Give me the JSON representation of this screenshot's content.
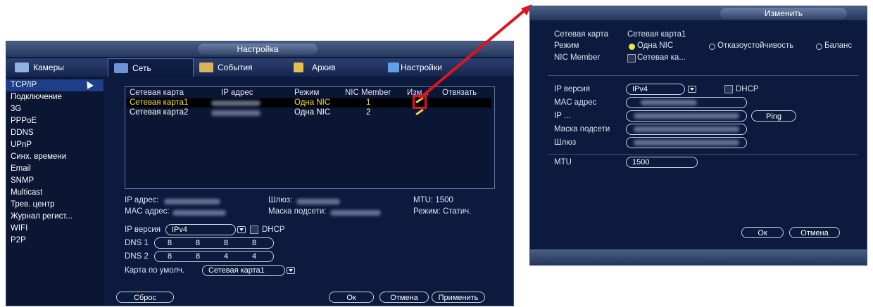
{
  "main": {
    "title": "Настройка",
    "tabs": [
      {
        "label": "Камеры",
        "icon": "camera-icon"
      },
      {
        "label": "Сеть",
        "icon": "network-icon"
      },
      {
        "label": "События",
        "icon": "events-icon"
      },
      {
        "label": "Архив",
        "icon": "archive-icon"
      },
      {
        "label": "Настройки",
        "icon": "settings-icon"
      }
    ],
    "sidebar": [
      "TCP/IP",
      "Подключение",
      "3G",
      "PPPoE",
      "DDNS",
      "UPnP",
      "Синх. времени",
      "Email",
      "SNMP",
      "Multicast",
      "Трев. центр",
      "Журнал регист...",
      "WIFI",
      "P2P"
    ],
    "table": {
      "headers": [
        "Сетевая карта",
        "IP адрес",
        "Режим",
        "NIC Member",
        "Изм...",
        "Отвязать"
      ],
      "rows": [
        {
          "card": "Сетевая карта1",
          "mode": "Одна NIC",
          "member": "1"
        },
        {
          "card": "Сетевая карта2",
          "mode": "Одна NIC",
          "member": "2"
        }
      ]
    },
    "info": {
      "ip_label": "IP адрес:",
      "gateway_label": "Шлюз:",
      "mtu": "MTU: 1500",
      "mac_label": "MAC адрес:",
      "mask_label": "Маска подсети:",
      "mode": "Режим: Статич."
    },
    "ip_version_label": "IP версия",
    "ip_version_value": "IPv4",
    "dhcp_label": "DHCP",
    "dns1_label": "DNS 1",
    "dns1": [
      "8",
      "8",
      "8",
      "8"
    ],
    "dns2_label": "DNS 2",
    "dns2": [
      "8",
      "8",
      "4",
      "4"
    ],
    "default_card_label": "Карта по умолч.",
    "default_card_value": "Сетевая карта1",
    "buttons": {
      "reset": "Сброс",
      "ok": "Ок",
      "cancel": "Отмена",
      "apply": "Применить"
    }
  },
  "edit": {
    "title": "Изменить",
    "card_label": "Сетевая карта",
    "card_value": "Сетевая карта1",
    "mode_label": "Режим",
    "mode_options": [
      "Одна NIC",
      "Отказоустойчивость",
      "Баланс"
    ],
    "nic_member_label": "NIC Member",
    "nic_member_value": "Сетевая ка...",
    "ip_version_label": "IP версия",
    "ip_version_value": "IPv4",
    "dhcp_label": "DHCP",
    "mac_label": "MAC адрес",
    "ip_label": "IP ...",
    "ping_label": "Ping",
    "mask_label": "Маска подсети",
    "gateway_label": "Шлюз",
    "mtu_label": "MTU",
    "mtu_value": "1500",
    "ok": "Ок",
    "cancel": "Отмена"
  },
  "colors": {
    "background": "#0b1a3d",
    "selection": "#1d3f8a",
    "highlight": "#f2e04a",
    "callout": "#e0141b"
  }
}
